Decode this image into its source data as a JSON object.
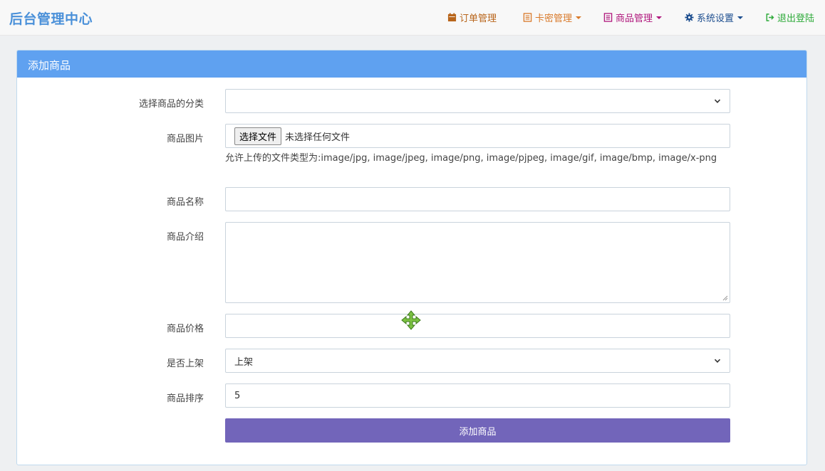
{
  "navbar": {
    "brand": "后台管理中心",
    "items": [
      {
        "label": "订单管理",
        "icon": "calendar-icon",
        "color": "#b8651b",
        "dropdown": false
      },
      {
        "label": "卡密管理",
        "icon": "list-icon",
        "color": "#d97a2b",
        "dropdown": true
      },
      {
        "label": "商品管理",
        "icon": "list-icon",
        "color": "#b0187d",
        "dropdown": true
      },
      {
        "label": "系统设置",
        "icon": "gear-icon",
        "color": "#1d4e8f",
        "dropdown": true
      },
      {
        "label": "退出登陆",
        "icon": "sign-out-icon",
        "color": "#2eaa3a",
        "dropdown": false
      }
    ]
  },
  "panel": {
    "title": "添加商品",
    "header_color": "#5fa1f0"
  },
  "form": {
    "category_label": "选择商品的分类",
    "category_value": "",
    "image_label": "商品图片",
    "file_button": "选择文件",
    "file_status": "未选择任何文件",
    "file_help": "允许上传的文件类型为:image/jpg, image/jpeg, image/png, image/pjpeg, image/gif, image/bmp, image/x-png",
    "name_label": "商品名称",
    "name_value": "",
    "desc_label": "商品介绍",
    "desc_value": "",
    "price_label": "商品价格",
    "price_value": "",
    "onsale_label": "是否上架",
    "onsale_value": "上架",
    "sort_label": "商品排序",
    "sort_value": "5",
    "submit_label": "添加商品",
    "submit_color": "#7265ba"
  },
  "cursor": {
    "icon": "move-cursor-icon",
    "color": "#7cc242"
  }
}
